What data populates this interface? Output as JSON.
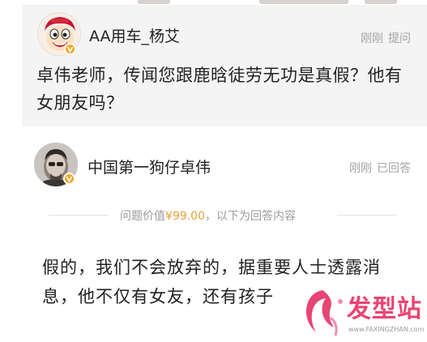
{
  "question": {
    "username": "AA用车_杨艾",
    "time": "刚刚",
    "action": "提问",
    "text": "卓伟老师，传闻您跟鹿晗徒劳无功是真假？他有女朋友吗？"
  },
  "answer": {
    "username": "中国第一狗仔卓伟",
    "time": "刚刚",
    "action": "已回答",
    "price_prefix": "问题价值",
    "price": "¥99.00",
    "price_suffix": "，以下为回答内容",
    "text": "假的，我们不会放弃的，据重要人士透露消息，他不仅有女友，还有孩子"
  },
  "watermark": {
    "title": "发型站",
    "url": "www.FAXINGZHAN.com"
  },
  "colors": {
    "badge": "#f5a623",
    "price": "#e5a13a",
    "watermark": "#e84474",
    "question_bg": "#f4f4f4"
  },
  "icons": {
    "question_avatar": "cartoon-face-avatar",
    "answer_avatar": "person-photo-avatar",
    "verified_badge": "verified-v-badge",
    "watermark_logo": "hair-silhouette-logo"
  }
}
